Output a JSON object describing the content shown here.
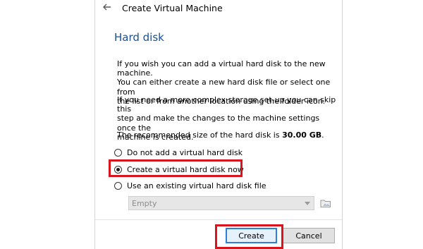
{
  "window": {
    "title": "Create Virtual Machine"
  },
  "page": {
    "heading": "Hard disk",
    "paragraph_1": "If you wish you can add a virtual hard disk to the new machine.\nYou can either create a new hard disk file or select one from\nthe list or from another location using the folder icon.",
    "paragraph_2": "If you need a more complex storage set-up you can skip this\nstep and make the changes to the machine settings once the\nmachine is created.",
    "recommended_prefix": "The recommended size of the hard disk is ",
    "recommended_size": "30.00 GB",
    "recommended_suffix": "."
  },
  "options": [
    {
      "label": "Do not add a virtual hard disk",
      "selected": false
    },
    {
      "label": "Create a virtual hard disk now",
      "selected": true
    },
    {
      "label": "Use an existing virtual hard disk file",
      "selected": false
    }
  ],
  "disk_select": {
    "value": "Empty",
    "disabled": true
  },
  "buttons": {
    "create": "Create",
    "cancel": "Cancel"
  },
  "icons": {
    "back": "back-arrow-icon",
    "folder": "folder-icon"
  },
  "colors": {
    "heading": "#1e4f8f",
    "highlight": "#d8141c",
    "focus_border": "#2f7fd6"
  }
}
